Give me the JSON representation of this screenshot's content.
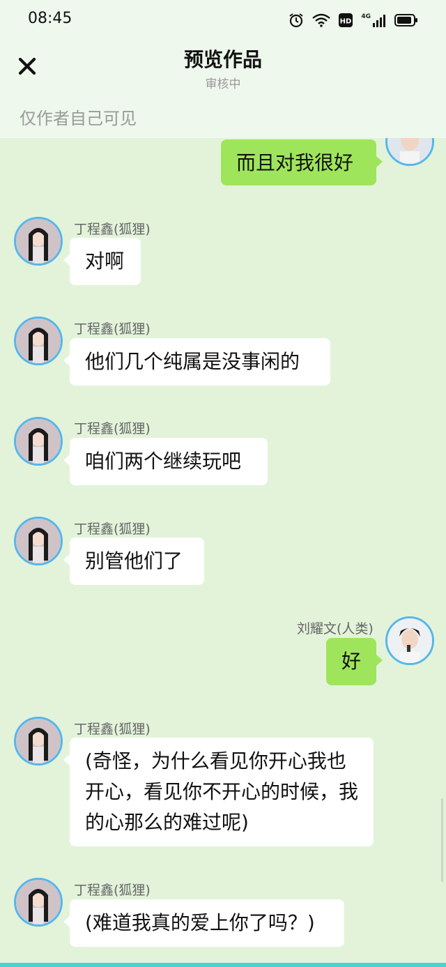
{
  "status_bar": {
    "time": "08:45",
    "network_label": "4G"
  },
  "header": {
    "title": "预览作品",
    "subtitle": "审核中",
    "visibility_note": "仅作者自己可见"
  },
  "messages": [
    {
      "side": "right",
      "name": "",
      "text": "而且对我很好"
    },
    {
      "side": "left",
      "name": "丁程鑫(狐狸)",
      "text": "对啊"
    },
    {
      "side": "left",
      "name": "丁程鑫(狐狸)",
      "text": "他们几个纯属是没事闲的"
    },
    {
      "side": "left",
      "name": "丁程鑫(狐狸)",
      "text": "咱们两个继续玩吧"
    },
    {
      "side": "left",
      "name": "丁程鑫(狐狸)",
      "text": "别管他们了"
    },
    {
      "side": "right",
      "name": "刘耀文(人类)",
      "text": "好"
    },
    {
      "side": "left",
      "name": "丁程鑫(狐狸)",
      "text": "(奇怪，为什么看见你开心我也开心，看见你不开心的时候，我的心那么的难过呢)"
    },
    {
      "side": "left",
      "name": "丁程鑫(狐狸)",
      "text": "(难道我真的爱上你了吗？)"
    }
  ],
  "colors": {
    "background": "#e2f3da",
    "header": "#eef8ec",
    "right_bubble": "#9fe55c",
    "left_bubble": "#ffffff",
    "avatar_ring": "#56b6ea"
  }
}
